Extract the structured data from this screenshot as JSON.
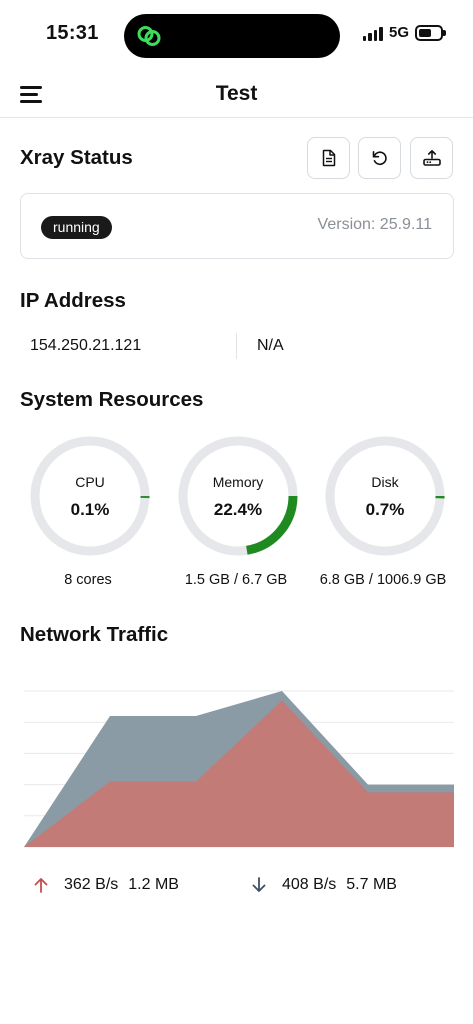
{
  "status_bar": {
    "time": "15:31",
    "network": "5G"
  },
  "header": {
    "title": "Test",
    "menu_icon": "hamburger-icon"
  },
  "xray": {
    "title": "Xray Status",
    "actions": [
      {
        "name": "logs",
        "icon": "document-icon"
      },
      {
        "name": "restart",
        "icon": "refresh-icon"
      },
      {
        "name": "update",
        "icon": "upload-icon"
      }
    ],
    "badge": "running",
    "version": "Version: 25.9.11"
  },
  "ip": {
    "title": "IP Address",
    "ipv4": "154.250.21.121",
    "ipv6": "N/A"
  },
  "resources": {
    "title": "System Resources",
    "items": [
      {
        "label": "CPU",
        "value": "0.1%",
        "percent": 0.1,
        "sub": "8 cores",
        "color": "#2e8b2e"
      },
      {
        "label": "Memory",
        "value": "22.4%",
        "percent": 22.4,
        "sub": "1.5 GB / 6.7 GB",
        "color": "#1f8a1f"
      },
      {
        "label": "Disk",
        "value": "0.7%",
        "percent": 0.7,
        "sub": "6.8 GB / 1006.9 GB",
        "color": "#1f8a1f"
      }
    ],
    "track_color": "#e5e7eb"
  },
  "traffic": {
    "title": "Network Traffic",
    "upload": {
      "rate": "362 B/s",
      "total": "1.2 MB",
      "color": "#c0504d"
    },
    "download": {
      "rate": "408 B/s",
      "total": "5.7 MB",
      "color": "#3b5068"
    }
  },
  "chart_data": {
    "type": "area",
    "x": [
      0,
      1,
      2,
      3,
      4,
      5
    ],
    "ylim": [
      0,
      1
    ],
    "grid": true,
    "series": [
      {
        "values": [
          0.0,
          0.84,
          0.84,
          1.0,
          0.4,
          0.4
        ],
        "color": "#8a9ba6"
      },
      {
        "values": [
          0.0,
          0.42,
          0.42,
          0.94,
          0.35,
          0.35
        ],
        "color": "#c27b76"
      }
    ]
  }
}
